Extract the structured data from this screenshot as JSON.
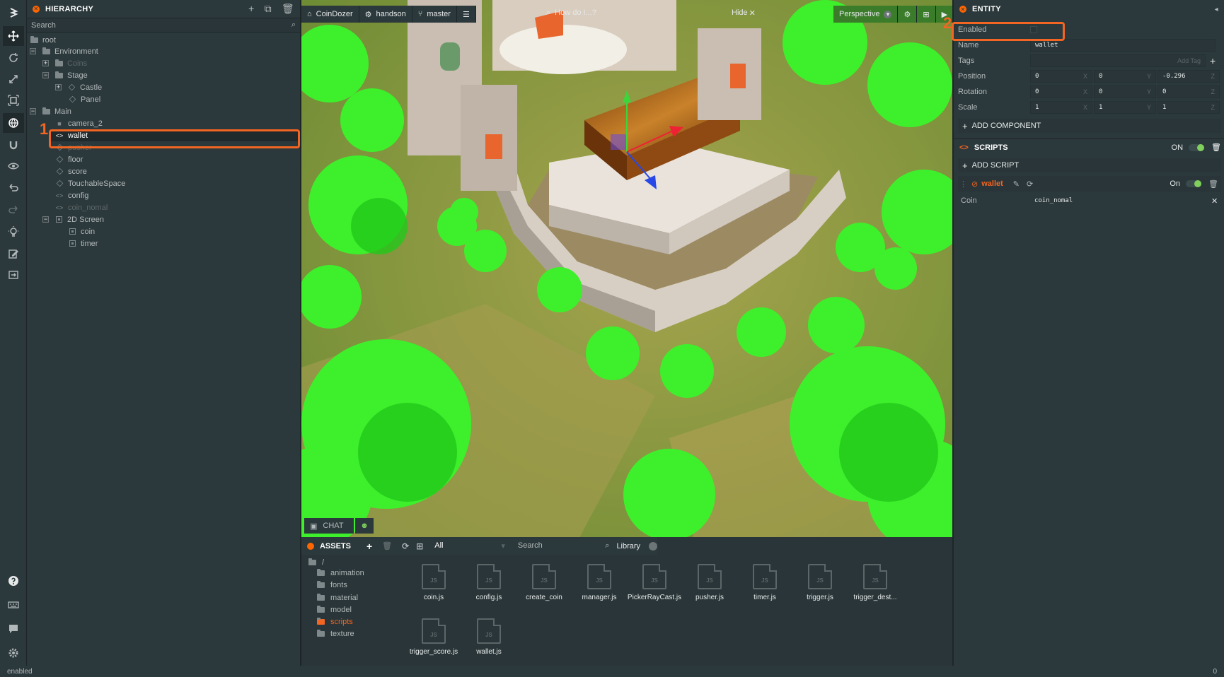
{
  "hierarchy": {
    "title": "HIERARCHY",
    "search_placeholder": "Search",
    "nodes": [
      "root",
      "Environment",
      "Coins",
      "Stage",
      "Castle",
      "Panel",
      "Main",
      "camera_2",
      "wallet",
      "pusher",
      "floor",
      "score",
      "TouchableSpace",
      "config",
      "coin_nomal",
      "2D Screen",
      "coin",
      "timer"
    ]
  },
  "viewport": {
    "project": "CoinDozer",
    "user": "handson",
    "branch": "master",
    "help_search": "How do I...?",
    "hide": "Hide",
    "camera": "Perspective"
  },
  "chat": {
    "label": "CHAT"
  },
  "assets": {
    "title": "ASSETS",
    "filter": "All",
    "search_placeholder": "Search",
    "library": "Library",
    "root": "/",
    "folders": [
      "animation",
      "fonts",
      "material",
      "model",
      "scripts",
      "texture"
    ],
    "files": [
      "coin.js",
      "config.js",
      "create_coin",
      "manager.js",
      "PickerRayCast.js",
      "pusher.js",
      "timer.js",
      "trigger.js",
      "trigger_dest...",
      "trigger_score.js",
      "wallet.js"
    ],
    "file_badge": "JS"
  },
  "entity": {
    "title": "ENTITY",
    "enabled_label": "Enabled",
    "name_label": "Name",
    "name_value": "wallet",
    "tags_label": "Tags",
    "add_tag": "Add Tag",
    "position_label": "Position",
    "position": [
      "0",
      "0",
      "-0.296"
    ],
    "rotation_label": "Rotation",
    "rotation": [
      "0",
      "0",
      "0"
    ],
    "scale_label": "Scale",
    "scale": [
      "1",
      "1",
      "1"
    ],
    "axes": [
      "X",
      "Y",
      "Z"
    ],
    "add_component": "ADD COMPONENT",
    "scripts_title": "SCRIPTS",
    "scripts_on": "ON",
    "add_script": "ADD SCRIPT",
    "script_name": "wallet",
    "script_on": "On",
    "coin_label": "Coin",
    "coin_value": "coin_nomal"
  },
  "callouts": [
    "1",
    "2"
  ],
  "status": {
    "text": "enabled",
    "right": "0"
  },
  "colors": {
    "accent": "#f26522",
    "panel": "#2c393c",
    "toggle_on": "#7fd15c"
  }
}
